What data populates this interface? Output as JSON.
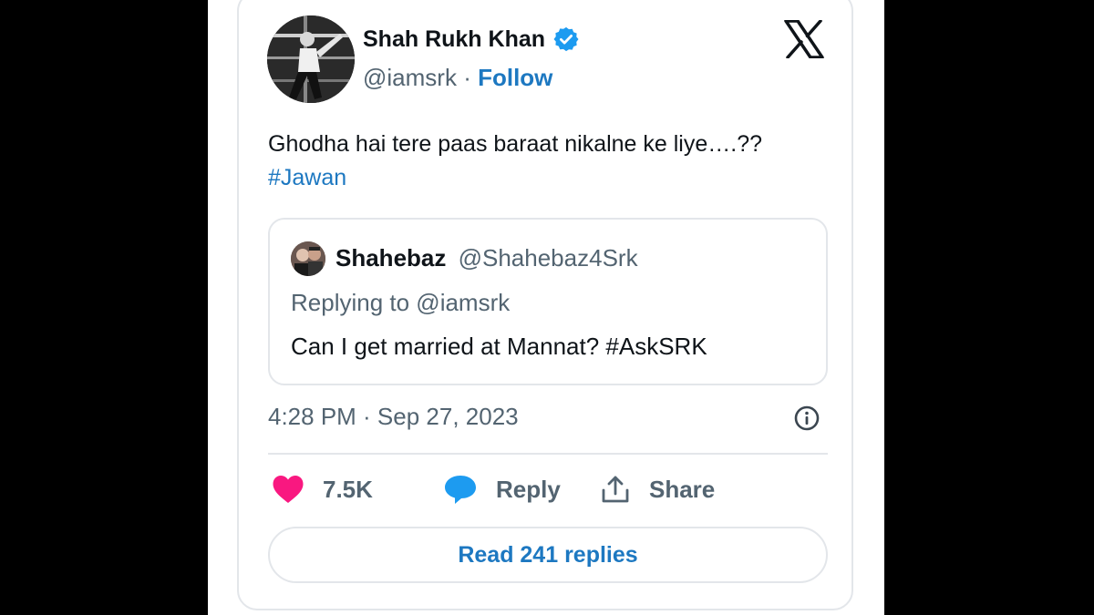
{
  "tweet": {
    "author_name": "Shah Rukh Khan",
    "handle": "@iamsrk",
    "separator": "·",
    "follow_label": "Follow",
    "text": "Ghodha hai tere paas baraat nikalne ke liye….??",
    "hashtag": "#Jawan",
    "timestamp": "4:28 PM · Sep 27, 2023"
  },
  "quoted_tweet": {
    "author_name": "Shahebaz",
    "handle": "@Shahebaz4Srk",
    "replying_to": "Replying to @iamsrk",
    "text": "Can I get married at Mannat? #AskSRK"
  },
  "actions": {
    "likes": "7.5K",
    "reply_label": "Reply",
    "share_label": "Share"
  },
  "read_replies_label": "Read 241 replies",
  "icons": {
    "verified": "verified-badge-icon",
    "logo": "x-logo-icon",
    "info": "info-icon",
    "like": "heart-icon",
    "reply": "speech-bubble-icon",
    "share": "share-icon"
  },
  "colors": {
    "link": "#1d78c1",
    "heart": "#f91880",
    "reply_bubble": "#1d9bf0",
    "verified": "#1d9bf0",
    "text": "#0f1419",
    "muted": "#536471"
  }
}
